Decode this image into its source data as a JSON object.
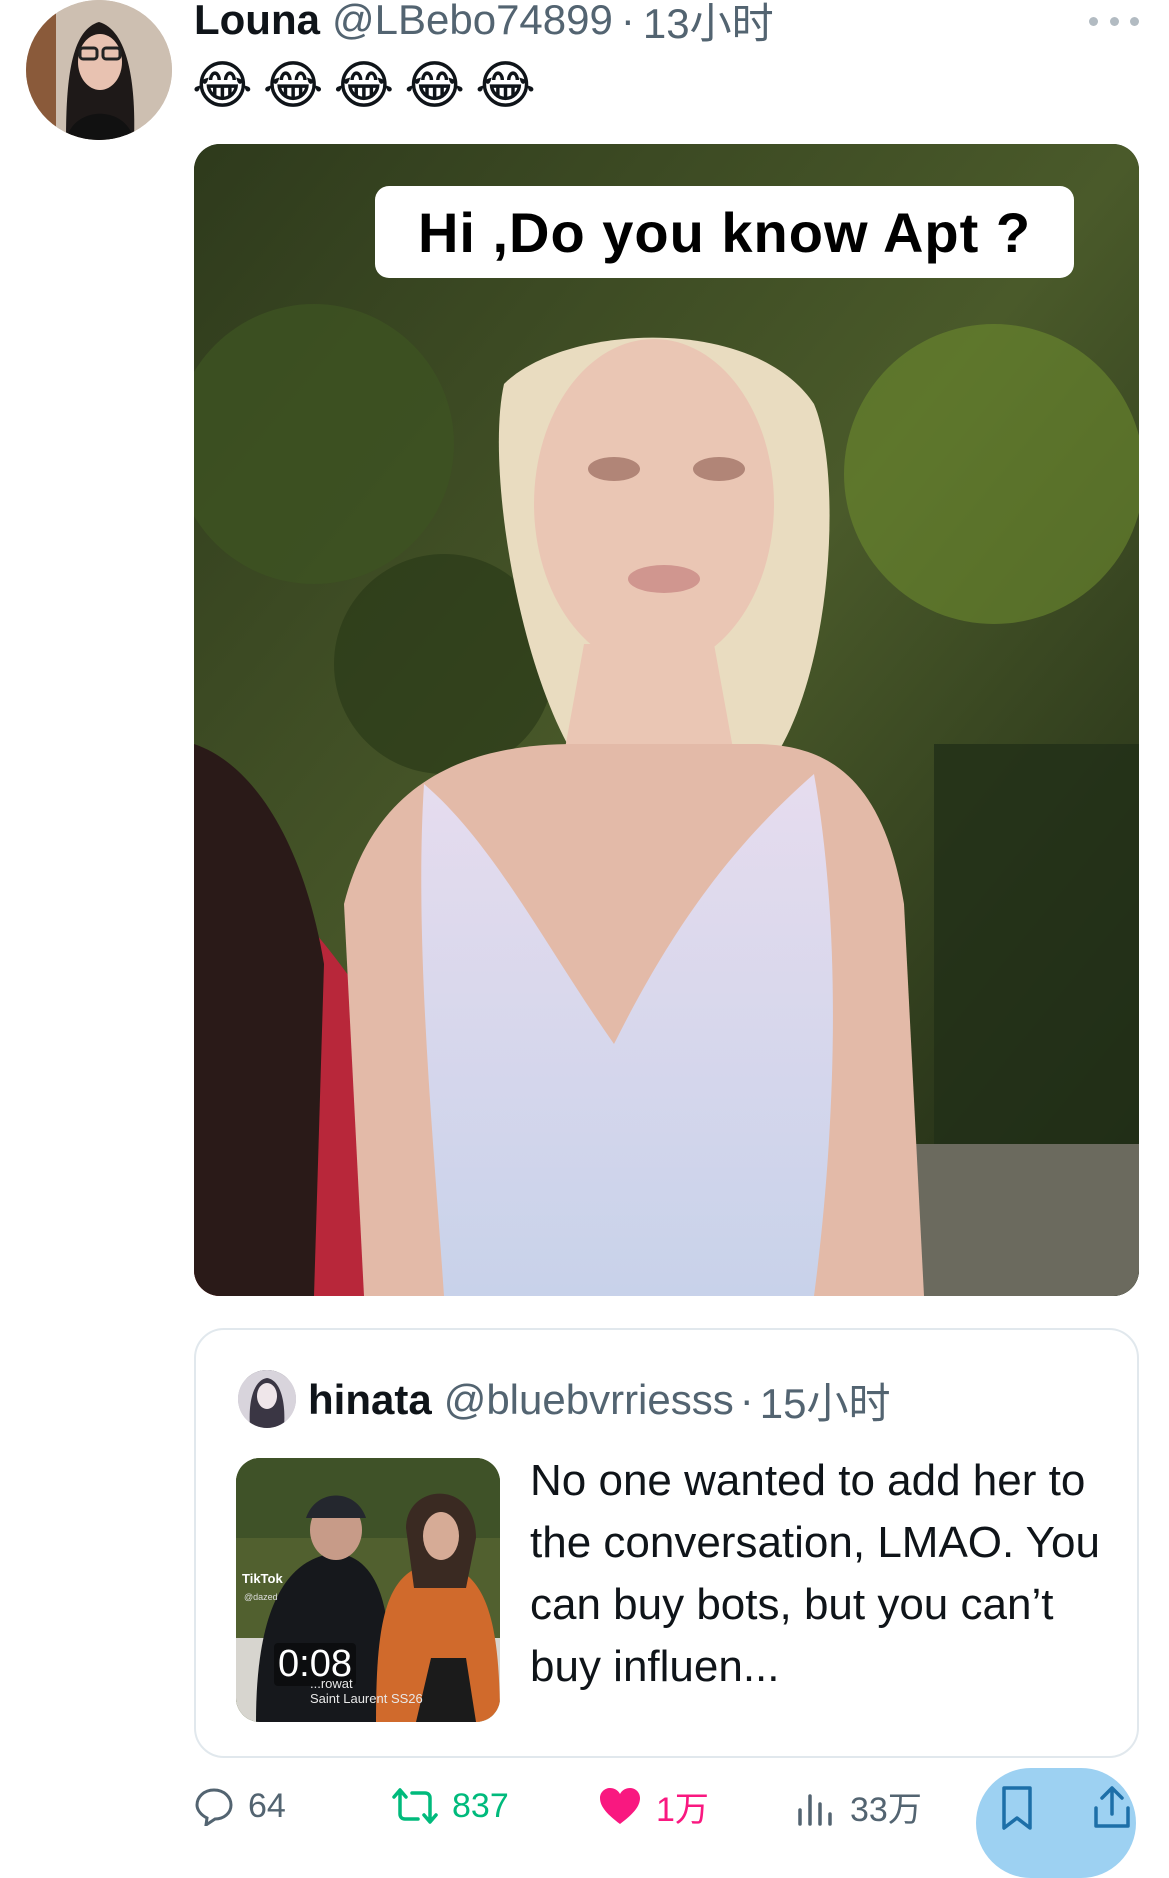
{
  "post": {
    "author_name": "Louna",
    "author_handle": "@LBebo74899",
    "time_ago": "13小时",
    "separator": "·",
    "body_emojis": [
      "😂",
      "😂",
      "😂",
      "😂",
      "😂"
    ],
    "media": {
      "caption": "Hi ,Do you know Apt ?"
    }
  },
  "quote": {
    "author_name": "hinata",
    "author_handle": "@bluebvrriesss",
    "time_ago": "15小时",
    "separator": "·",
    "text": "No one wanted to add her to the conversation, LMAO. You can buy bots, but you can’t buy influen...",
    "thumbnail": {
      "duration": "0:08",
      "watermark": "TikTok",
      "watermark_user": "@dazed",
      "caption_line1": "...rowat",
      "caption_line2": "Saint Laurent SS26"
    }
  },
  "actions": {
    "replies": "64",
    "reposts": "837",
    "likes": "1万",
    "views": "33万"
  },
  "colors": {
    "text": "#0f1419",
    "secondary": "#536471",
    "repost": "#00ba7c",
    "like": "#f91880",
    "accent": "#1d9bf0"
  }
}
